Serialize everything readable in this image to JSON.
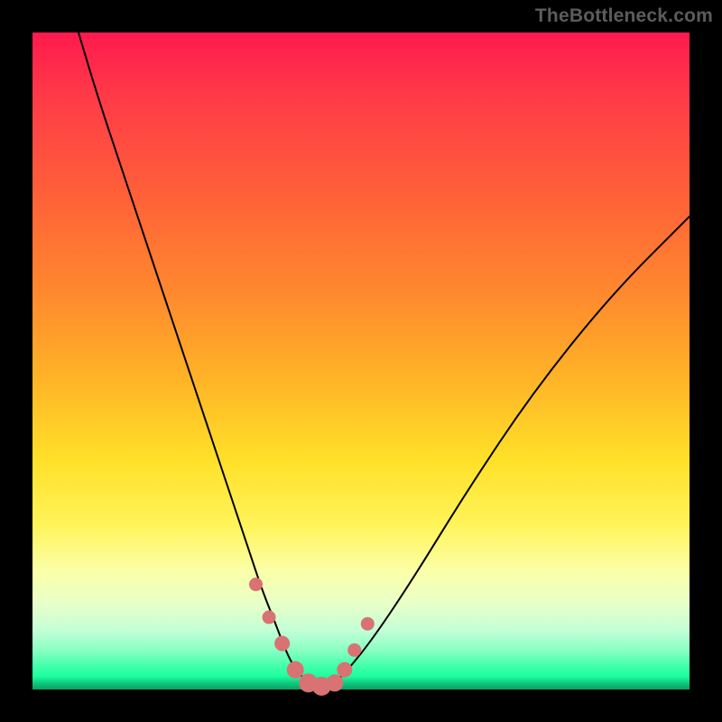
{
  "watermark": "TheBottleneck.com",
  "colors": {
    "frame_bg": "#000000",
    "curve": "#000000",
    "marker": "#d97272",
    "gradient_top": "#ff1a4d",
    "gradient_mid": "#ffe028",
    "gradient_bottom": "#10c97f"
  },
  "chart_data": {
    "type": "line",
    "title": "",
    "xlabel": "",
    "ylabel": "",
    "xlim": [
      0,
      100
    ],
    "ylim": [
      0,
      100
    ],
    "grid": false,
    "series": [
      {
        "name": "bottleneck-curve",
        "x": [
          7,
          10,
          14,
          18,
          22,
          26,
          30,
          33,
          35,
          37,
          38.5,
          40,
          42,
          44,
          46,
          48,
          52,
          58,
          66,
          76,
          88,
          100
        ],
        "y": [
          100,
          90,
          78,
          66,
          54,
          42,
          30,
          21,
          15,
          10,
          6,
          3,
          1,
          0.5,
          1,
          3,
          8,
          17,
          30,
          45,
          60,
          72
        ]
      }
    ],
    "markers": {
      "name": "highlighted-points",
      "x": [
        34,
        36,
        38,
        40,
        42,
        44,
        46,
        47.5,
        49,
        51
      ],
      "y": [
        16,
        11,
        7,
        3,
        1,
        0.5,
        1,
        3,
        6,
        10
      ],
      "r": [
        7,
        7,
        8,
        9,
        10,
        10,
        9,
        8,
        7,
        7
      ]
    }
  }
}
